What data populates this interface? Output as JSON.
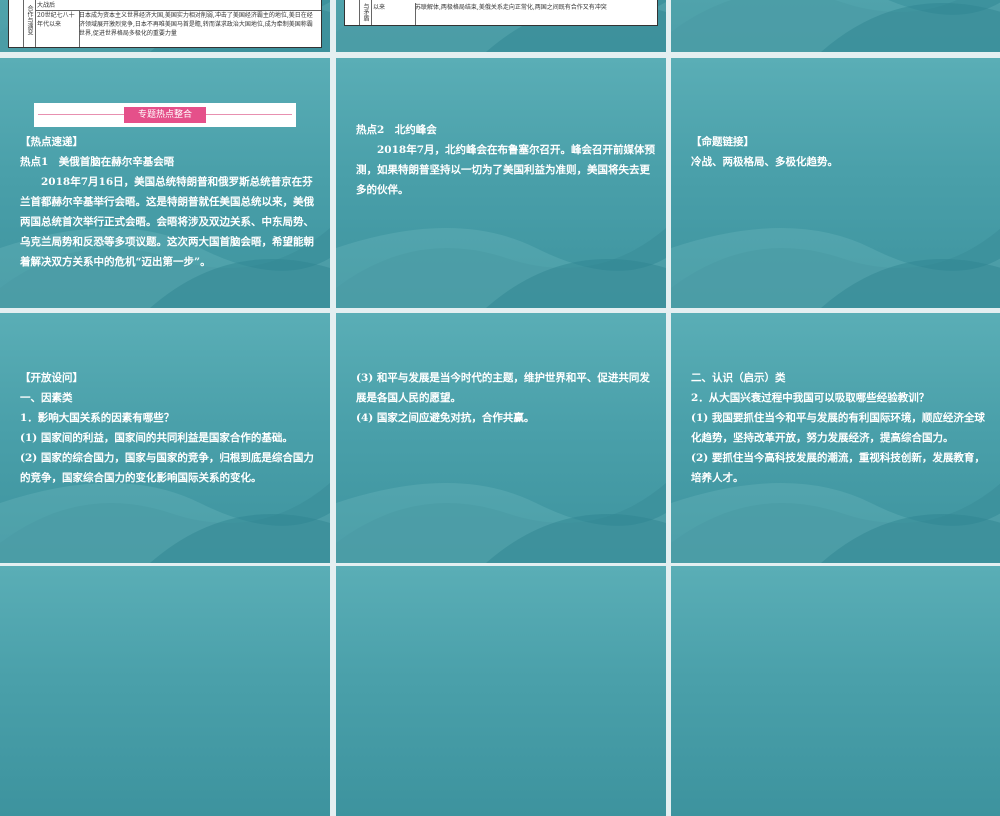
{
  "slides_top": [
    {
      "header_cell": "大战后",
      "side_label": "合作与演变",
      "period": "20世纪七八十年代以来",
      "content": "日本成为资本主义世界经济大国,美国实力相对削弱,冲击了美国经济霸主的地位,美日在经济领域展开激烈竞争,日本不再唯美国马首是瞻,转而谋求政治大国地位,成为牵制美国称霸世界,促进世界格局多极化的重要力量"
    },
    {
      "side_label": "与矛盾",
      "period": "以来",
      "content": "苏联解体,两极格局结束,美俄关系走向正常化,两国之间既有合作又有冲突"
    }
  ],
  "slide4": {
    "banner": "专题热点整合",
    "heading": "【热点速递】",
    "subheading": "热点1　美俄首脑在赫尔辛基会晤",
    "body": "2018年7月16日，美国总统特朗普和俄罗斯总统普京在芬兰首都赫尔辛基举行会晤。这是特朗普就任美国总统以来，美俄两国总统首次举行正式会晤。会晤将涉及双边关系、中东局势、乌克兰局势和反恐等多项议题。这次两大国首脑会晤，希望能朝着解决双方关系中的危机“迈出第一步”。"
  },
  "slide5": {
    "subheading": "热点2　北约峰会",
    "body": "2018年7月，北约峰会在布鲁塞尔召开。峰会召开前媒体预测，如果特朗普坚持以一切为了美国利益为准则，美国将失去更多的伙伴。"
  },
  "slide6": {
    "heading": "【命题链接】",
    "body": "冷战、两极格局、多极化趋势。"
  },
  "slide7": {
    "lines": [
      "【开放设问】",
      "一、因素类",
      "1．影响大国关系的因素有哪些？",
      "(1) 国家间的利益，国家间的共同利益是国家合作的基础。",
      "(2) 国家的综合国力，国家与国家的竞争，归根到底是综合国力的竞争，国家综合国力的变化影响国际关系的变化。"
    ]
  },
  "slide8": {
    "lines": [
      "(3) 和平与发展是当今时代的主题，维护世界和平、促进共同发展是各国人民的愿望。",
      "(4) 国家之间应避免对抗，合作共赢。"
    ]
  },
  "slide9": {
    "lines": [
      "二、认识（启示）类",
      "2．从大国兴衰过程中我国可以吸取哪些经验教训？",
      "(1) 我国要抓住当今和平与发展的有利国际环境，顺应经济全球化趋势，坚持改革开放，努力发展经济，提高综合国力。",
      "(2) 要抓住当今高科技发展的潮流，重视科技创新，发展教育，培养人才。"
    ]
  }
}
